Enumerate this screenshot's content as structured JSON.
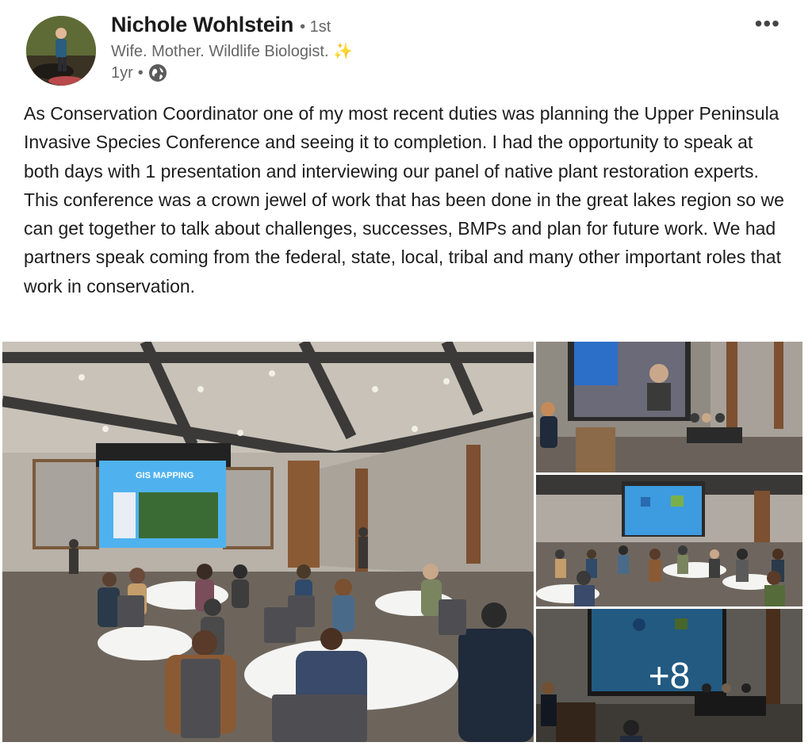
{
  "post": {
    "author_name": "Nichole Wohlstein",
    "degree": "• 1st",
    "headline": "Wife. Mother. Wildlife Biologist.",
    "headline_emoji": "✨",
    "time": "1yr",
    "meta_sep": "•",
    "visibility_icon": "globe-icon",
    "menu_label": "•••",
    "text": "As Conservation Coordinator one of my most recent duties was planning the Upper Peninsula Invasive Species Conference and seeing it to completion. I had the opportunity to speak at both days with 1 presentation and interviewing our panel of native plant restoration experts. This conference was a crown jewel of work that has been done in the great lakes region so we can get together to talk about challenges, successes, BMPs and plan for future work. We had partners speak coming from the federal, state, local, tribal and many other important roles that work in conservation."
  },
  "photos": {
    "main_screen_title": "GIS MAPPING",
    "more_count": "+8"
  },
  "colors": {
    "text": "#1c1c1c",
    "muted": "#666666",
    "screen_blue": "#3d9be0"
  }
}
